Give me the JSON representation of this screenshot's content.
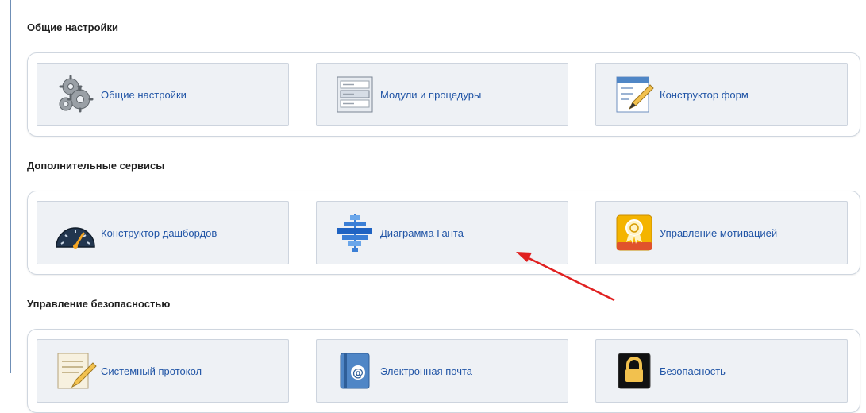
{
  "sections": [
    {
      "title": "Общие настройки",
      "tiles": [
        {
          "label": "Общие настройки",
          "icon": "gears-icon"
        },
        {
          "label": "Модули и процедуры",
          "icon": "modules-list-icon"
        },
        {
          "label": "Конструктор форм",
          "icon": "form-designer-icon"
        }
      ]
    },
    {
      "title": "Дополнительные сервисы",
      "tiles": [
        {
          "label": "Конструктор дашбордов",
          "icon": "dashboard-gauge-icon"
        },
        {
          "label": "Диаграмма Ганта",
          "icon": "gantt-chart-icon"
        },
        {
          "label": "Управление мотивацией",
          "icon": "award-medal-icon"
        }
      ]
    },
    {
      "title": "Управление безопасностью",
      "tiles": [
        {
          "label": "Системный протокол",
          "icon": "system-log-icon"
        },
        {
          "label": "Электронная почта",
          "icon": "email-book-icon"
        },
        {
          "label": "Безопасность",
          "icon": "security-lock-icon"
        }
      ]
    }
  ],
  "colors": {
    "tile_bg": "#eef1f5",
    "tile_border": "#cdd4de",
    "link_text": "#2155a6",
    "annotation_arrow": "#e02020"
  }
}
